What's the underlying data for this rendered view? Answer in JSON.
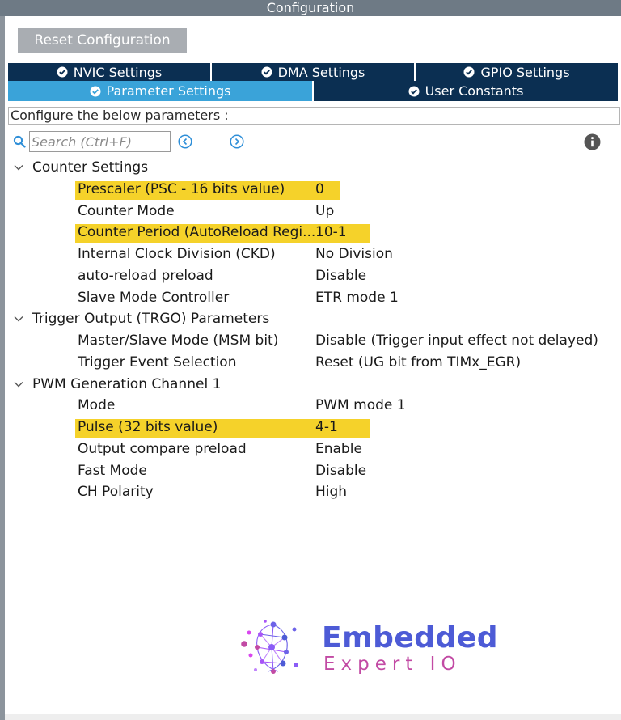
{
  "window": {
    "title": "Configuration"
  },
  "toolbar": {
    "reset_label": "Reset Configuration"
  },
  "tabs": {
    "row1": [
      {
        "label": "NVIC Settings",
        "icon": "check-circle-icon"
      },
      {
        "label": "DMA Settings",
        "icon": "check-circle-icon"
      },
      {
        "label": "GPIO Settings",
        "icon": "check-circle-icon"
      }
    ],
    "row2": [
      {
        "label": "Parameter Settings",
        "icon": "check-circle-icon",
        "active": true
      },
      {
        "label": "User Constants",
        "icon": "check-circle-icon"
      }
    ]
  },
  "configure_text": "Configure the below parameters :",
  "search": {
    "placeholder": "Search (Ctrl+F)"
  },
  "groups": [
    {
      "label": "Counter Settings",
      "params": [
        {
          "name": "Prescaler (PSC - 16 bits value)",
          "value": "0",
          "highlighted": true
        },
        {
          "name": "Counter Mode",
          "value": "Up"
        },
        {
          "name": "Counter Period (AutoReload Regi...",
          "value": "10-1",
          "highlighted": true
        },
        {
          "name": "Internal Clock Division (CKD)",
          "value": "No Division"
        },
        {
          "name": "auto-reload preload",
          "value": "Disable"
        },
        {
          "name": "Slave Mode Controller",
          "value": "ETR mode 1"
        }
      ]
    },
    {
      "label": "Trigger Output (TRGO) Parameters",
      "params": [
        {
          "name": "Master/Slave Mode (MSM bit)",
          "value": "Disable (Trigger input effect not delayed)"
        },
        {
          "name": "Trigger Event Selection",
          "value": "Reset (UG bit from TIMx_EGR)"
        }
      ]
    },
    {
      "label": "PWM Generation Channel 1",
      "params": [
        {
          "name": "Mode",
          "value": "PWM mode 1"
        },
        {
          "name": "Pulse (32 bits value)",
          "value": "4-1",
          "highlighted": true
        },
        {
          "name": "Output compare preload",
          "value": "Enable"
        },
        {
          "name": "Fast Mode",
          "value": "Disable"
        },
        {
          "name": "CH Polarity",
          "value": "High"
        }
      ]
    }
  ],
  "logo": {
    "line1": "Embedded",
    "line2": "Expert IO"
  },
  "colors": {
    "tab_dark": "#0b2f52",
    "tab_active": "#3aa3d9",
    "highlight": "#f5d22a",
    "title_bar": "#6e7a85"
  }
}
